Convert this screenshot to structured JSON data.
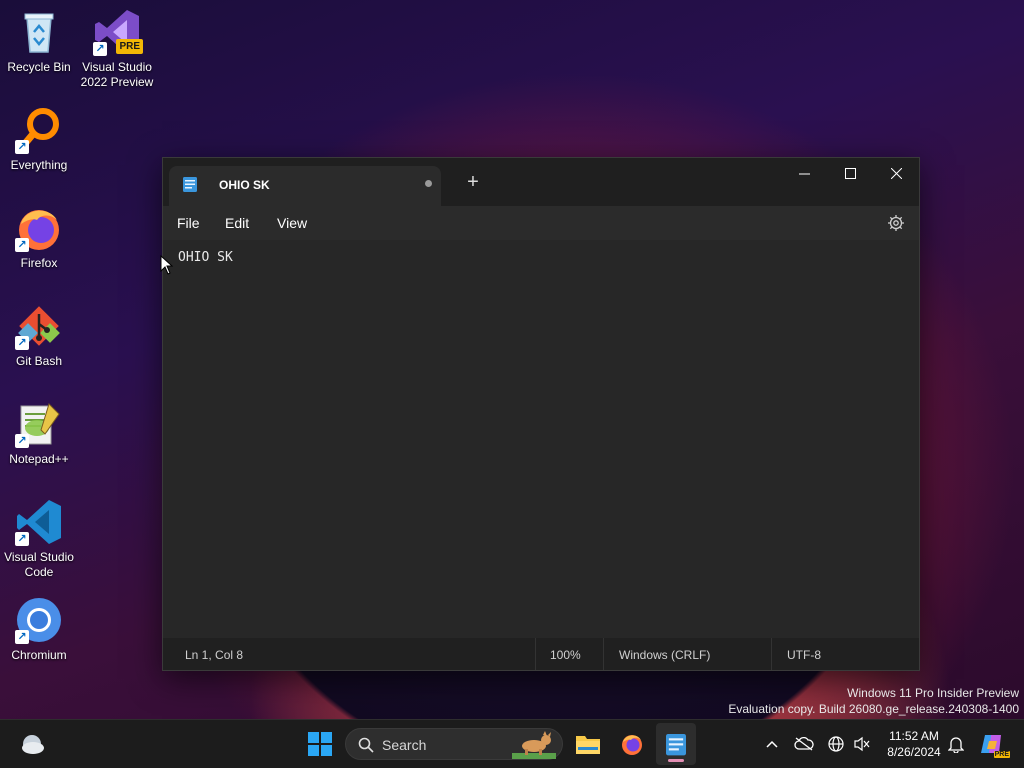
{
  "desktop": {
    "icons": [
      {
        "label": "Recycle Bin"
      },
      {
        "label": "Visual Studio 2022 Preview",
        "badge": "PRE"
      },
      {
        "label": "Everything"
      },
      {
        "label": "Firefox"
      },
      {
        "label": "Git Bash"
      },
      {
        "label": "Notepad++"
      },
      {
        "label": "Visual Studio Code"
      },
      {
        "label": "Chromium"
      }
    ]
  },
  "notepad": {
    "tab_title": "OHIO SK",
    "new_tab": "+",
    "menu": {
      "file": "File",
      "edit": "Edit",
      "view": "View"
    },
    "content": "OHIO SK",
    "status": {
      "position": "Ln 1, Col 8",
      "zoom": "100%",
      "line_ending": "Windows (CRLF)",
      "encoding": "UTF-8"
    }
  },
  "watermark": {
    "line1": "Windows 11 Pro Insider Preview",
    "line2": "Evaluation copy. Build 26080.ge_release.240308-1400"
  },
  "taskbar": {
    "search_label": "Search",
    "time": "11:52 AM",
    "date": "8/26/2024",
    "copilot_badge": "PRE"
  },
  "colors": {
    "accent": "#0078d4",
    "window_bg": "#272727",
    "taskbar_bg": "#1c1c1c"
  }
}
